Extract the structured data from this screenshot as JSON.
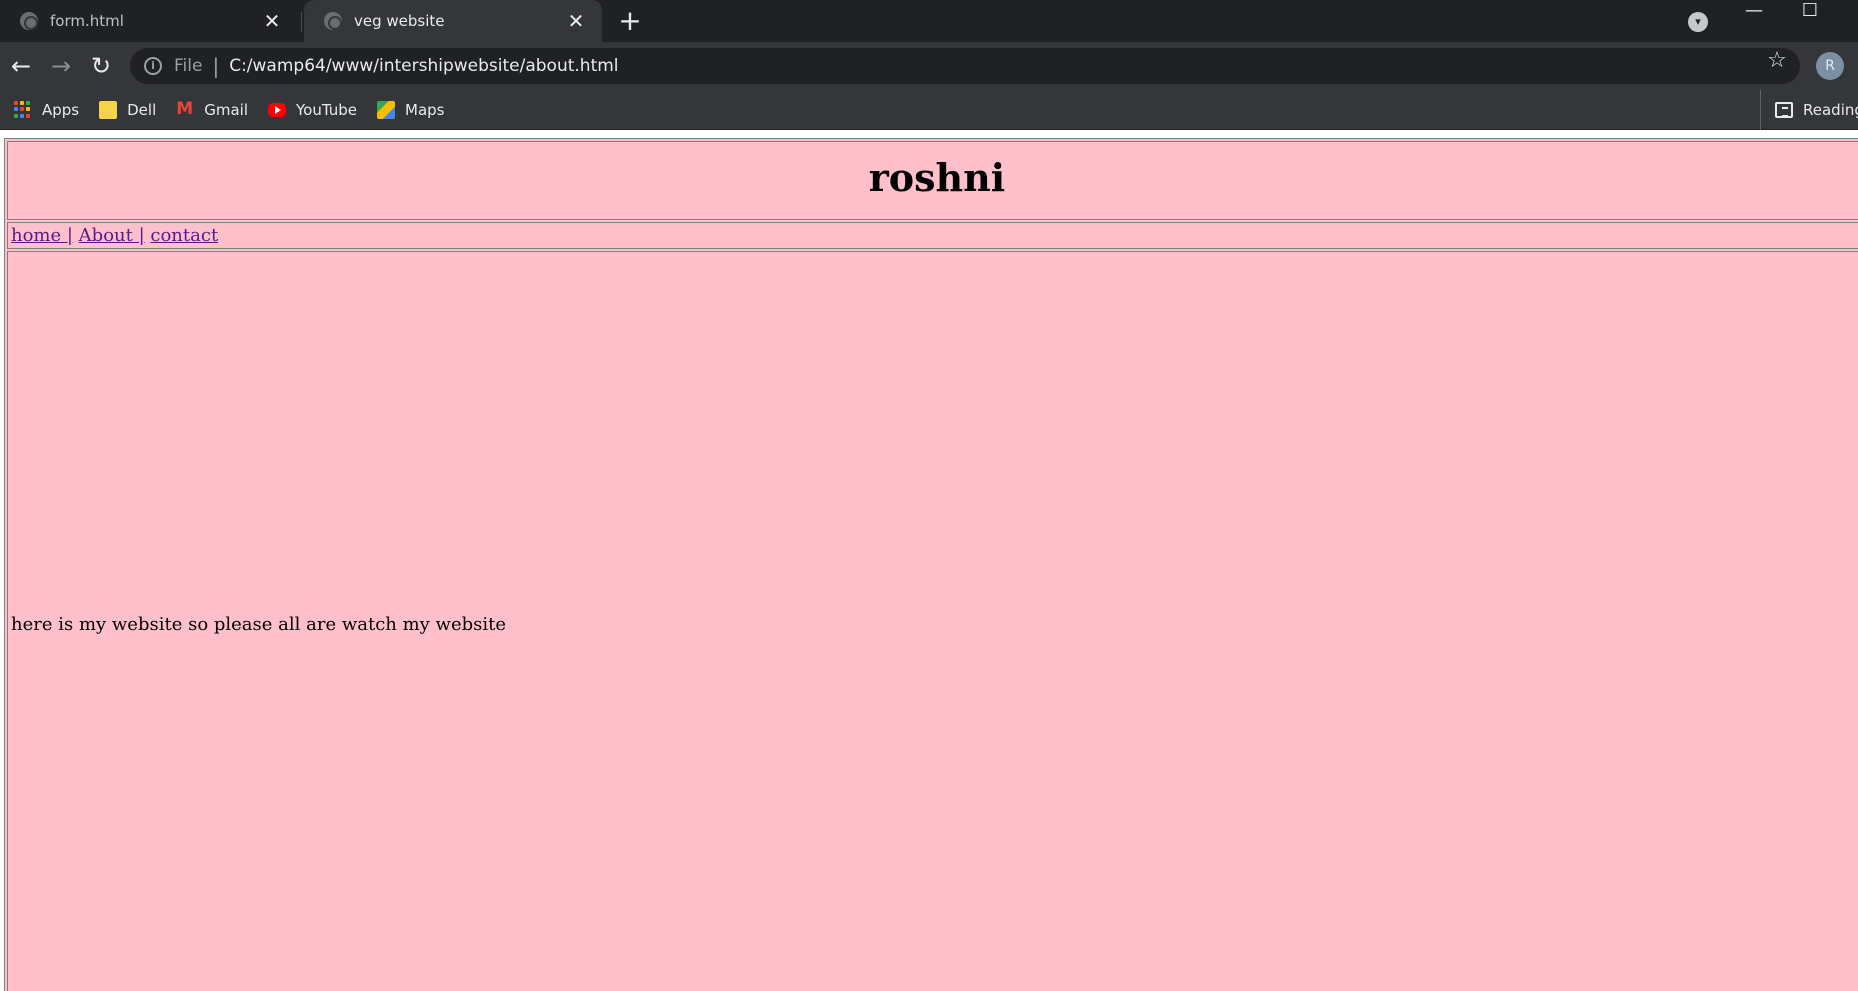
{
  "browser": {
    "tabs": [
      {
        "title": "form.html",
        "active": false
      },
      {
        "title": "veg website",
        "active": true
      }
    ],
    "close_glyph": "✕",
    "new_tab_glyph": "+",
    "address": {
      "scheme_label": "File",
      "url": "C:/wamp64/www/intershipwebsite/about.html"
    },
    "profile_initial": "R",
    "bookmarks": [
      {
        "label": "Apps",
        "icon": "apps-grid-icon"
      },
      {
        "label": "Dell",
        "icon": "folder-icon"
      },
      {
        "label": "Gmail",
        "icon": "gmail-icon"
      },
      {
        "label": "YouTube",
        "icon": "youtube-icon"
      },
      {
        "label": "Maps",
        "icon": "maps-icon"
      }
    ],
    "reading_list_label": "Reading"
  },
  "page": {
    "background": "#ffc0cb",
    "title": "roshni",
    "nav": [
      {
        "label": "home |"
      },
      {
        "label": "About |"
      },
      {
        "label": "contact"
      }
    ],
    "body_text": "here is my website so please all are watch my website"
  }
}
